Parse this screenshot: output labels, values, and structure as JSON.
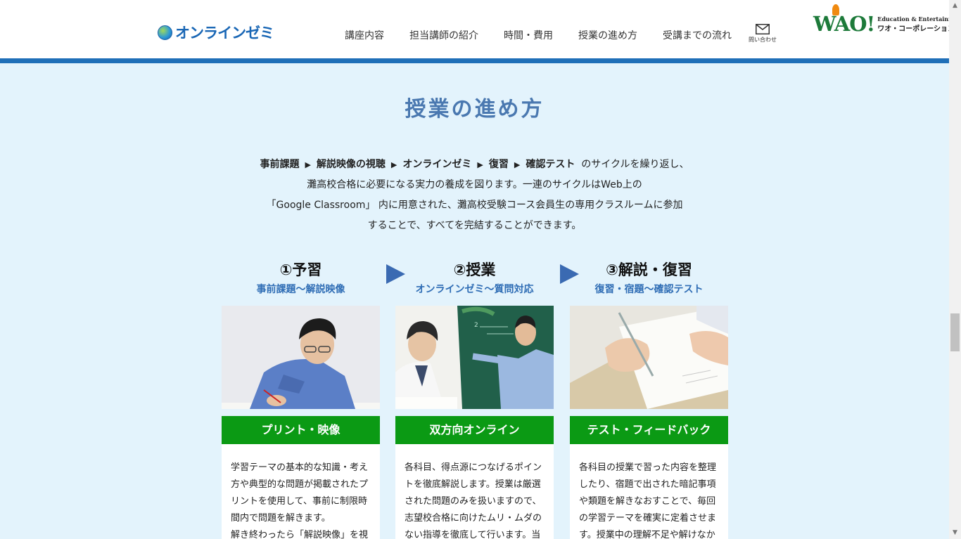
{
  "header": {
    "logo_text": "オンラインゼミ",
    "nav": [
      "講座内容",
      "担当講師の紹介",
      "時間・費用",
      "授業の進め方",
      "受講までの流れ"
    ],
    "contact_label": "問い合わせ",
    "brand_mark": "WAO!",
    "brand_en": "Education & Entertainment",
    "brand_jp": "ワオ・コーポレーション"
  },
  "section": {
    "title": "授業の進め方",
    "steps_line": [
      "事前課題",
      "解説映像の視聴",
      "オンラインゼミ",
      "復習",
      "確認テスト"
    ],
    "steps_tail": "のサイクルを繰り返し、",
    "line2": "灘高校合格に必要になる実力の養成を図ります。一連のサイクルはWeb上の",
    "line3": "「Google Classroom」 内に用意された、灘高校受験コース会員生の専用クラスルームに参加",
    "line4": "することで、すべてを完結することができます。"
  },
  "steps": [
    {
      "title": "①予習",
      "sub": "事前課題〜解説映像",
      "label": "プリント・映像",
      "text": [
        "学習テーマの基本的な知識・考え",
        "方や典型的な問題が掲載されたプ",
        "リントを使用して、事前に制限時",
        "間内で問題を解きます。",
        "解き終わったら「解説映像」を視"
      ]
    },
    {
      "title": "②授業",
      "sub": "オンラインゼミ〜質問対応",
      "label": "双方向オンライン",
      "text": [
        "各科目、得点源につなげるポイン",
        "トを徹底解説します。授業は厳選",
        "された問題のみを扱いますので、",
        "志望校合格に向けたムリ・ムダの",
        "ない指導を徹底して行います。当"
      ]
    },
    {
      "title": "③解説・復習",
      "sub": "復習・宿題〜確認テスト",
      "label": "テスト・フィードバック",
      "text": [
        "各科目の授業で習った内容を整理",
        "したり、宿題で出された暗記事項",
        "や類題を解きなおすことで、毎回",
        "の学習テーマを確実に定着させま",
        "す。授業中の理解不足や解けなか"
      ]
    }
  ],
  "colors": {
    "accent_blue": "#1f6fb8",
    "title_blue": "#4a78b0",
    "label_green": "#0b9a14",
    "bg": "#e3f3fc"
  }
}
